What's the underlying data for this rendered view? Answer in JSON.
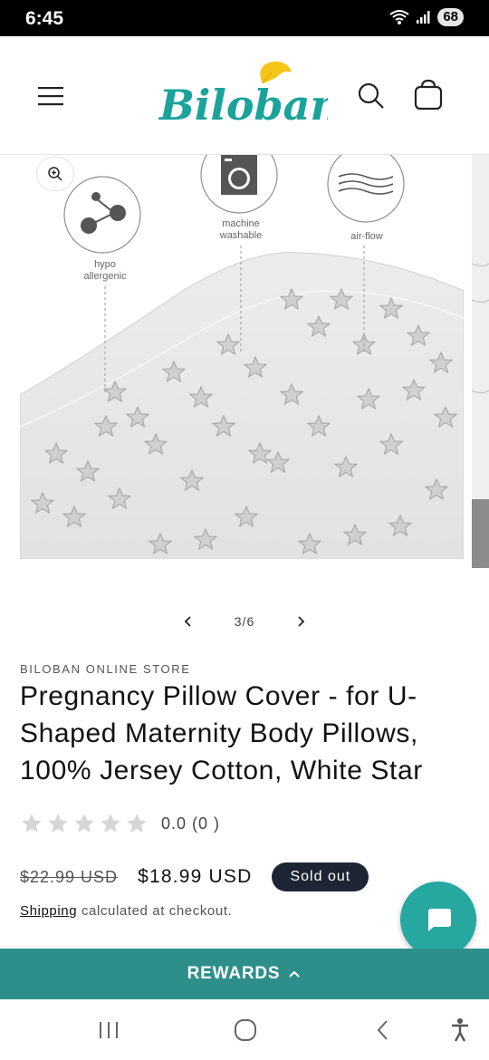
{
  "status": {
    "time": "6:45",
    "battery": "68",
    "wifi_badge": "5"
  },
  "header": {
    "brand": "Biloban"
  },
  "gallery": {
    "features": [
      {
        "label_line1": "hypo",
        "label_line2": "allergenic",
        "icon": "molecule-icon"
      },
      {
        "label_line1": "machine",
        "label_line2": "washable",
        "icon": "washing-machine-icon"
      },
      {
        "label_line1": "air-flow",
        "label_line2": "",
        "icon": "air-flow-icon"
      }
    ],
    "counter": "3/6"
  },
  "product": {
    "vendor": "BILOBAN ONLINE STORE",
    "title": "Pregnancy Pillow Cover - for U-Shaped Maternity Body Pillows, 100% Jersey Cotton, White Star",
    "rating_text": "0.0 (0 )",
    "rating_value": 0,
    "rating_max": 5,
    "price_old": "$22.99 USD",
    "price_new": "$18.99 USD",
    "badge": "Sold out",
    "shipping_link": "Shipping",
    "shipping_text": " calculated at checkout."
  },
  "rewards": {
    "label": "REWARDS"
  },
  "colors": {
    "accent": "#2e8f8a",
    "chat": "#26a7a0",
    "badge_bg": "#1d2433",
    "logo_teal": "#1aa39a",
    "logo_yellow": "#f5c518"
  }
}
